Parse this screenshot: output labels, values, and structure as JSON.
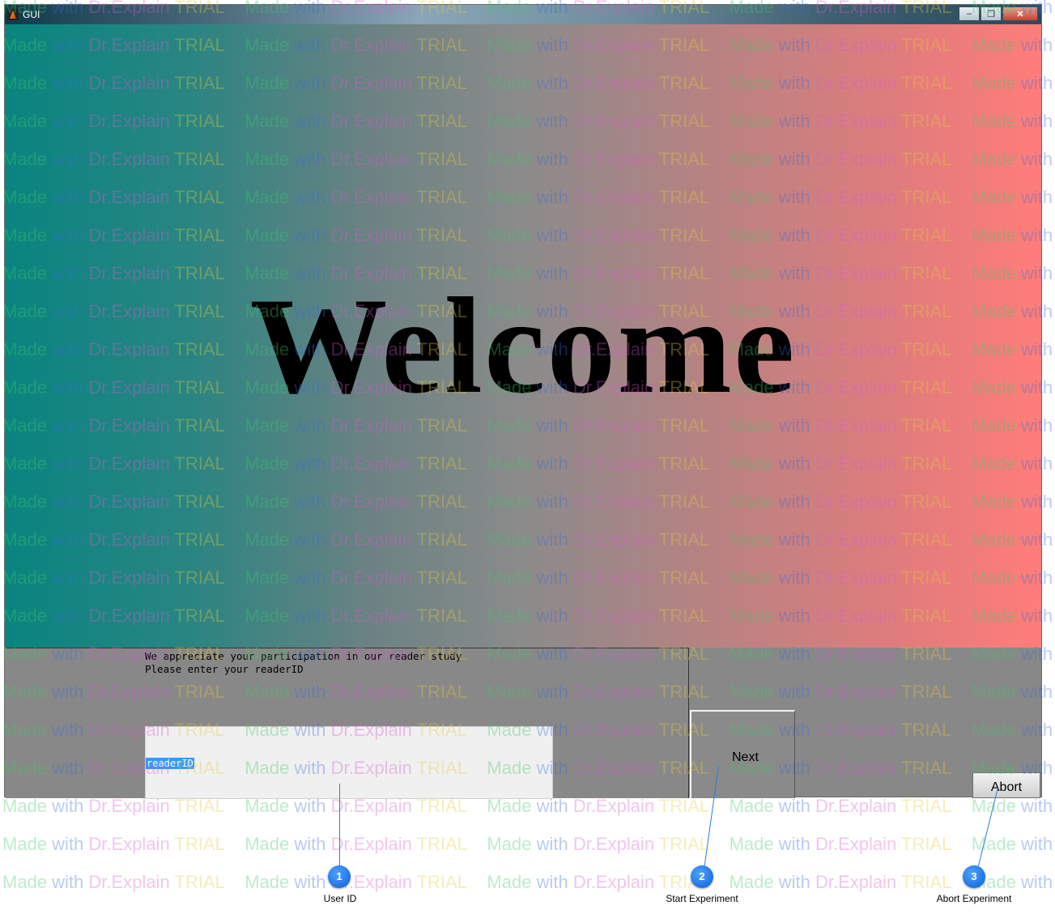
{
  "window": {
    "title": "GUI",
    "minimize_glyph": "–",
    "restore_glyph": "❐",
    "close_glyph": "✕"
  },
  "main": {
    "welcome_text": "Welcome",
    "message_line1": "We appreciate your participation in our reader study",
    "message_line2": "Please enter your readerID",
    "reader_field_value": "readerID",
    "next_label": "Next",
    "abort_label": "Abort"
  },
  "watermark": {
    "made": "Made ",
    "with": "with ",
    "brand": "Dr.Explain ",
    "trial": "TRIAL"
  },
  "callouts": [
    {
      "number": "1",
      "label": "User ID"
    },
    {
      "number": "2",
      "label": "Start Experiment"
    },
    {
      "number": "3",
      "label": "Abort Experiment"
    }
  ],
  "colors": {
    "gradient_left": "#08857f",
    "gradient_right": "#ff7d7a",
    "panel_gray": "#888888",
    "callout_blue": "#1a6fe0",
    "selection_blue": "#3399ff"
  }
}
